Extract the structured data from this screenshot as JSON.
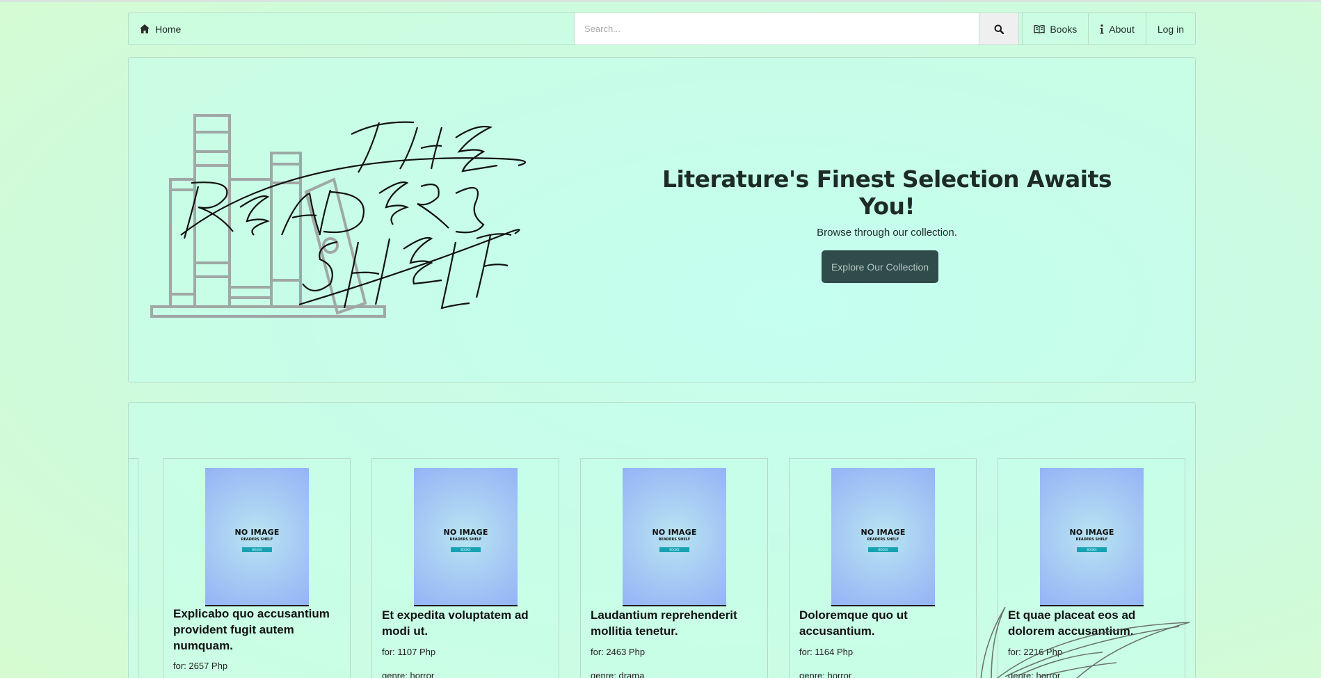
{
  "navbar": {
    "home_label": "Home",
    "search_placeholder": "Search...",
    "items": [
      {
        "label": "Books",
        "icon": "book-icon"
      },
      {
        "label": "About",
        "icon": "info-icon"
      },
      {
        "label": "Log in"
      }
    ]
  },
  "hero": {
    "logo_text": [
      "THE",
      "READERS",
      "SHELF"
    ],
    "title": "Literature's Finest Selection Awaits You!",
    "subtitle": "Browse through our collection.",
    "button_label": "Explore Our Collection"
  },
  "cover_placeholder": {
    "title": "NO IMAGE",
    "subtitle": "READERS SHELF",
    "tag": "BOOKS"
  },
  "books": [
    {
      "title": "Explicabo quo accusantium provident fugit autem numquam.",
      "price": "for: 2657 Php",
      "genre": ""
    },
    {
      "title": "Et expedita voluptatem ad modi ut.",
      "price": "for: 1107 Php",
      "genre": "genre: horror"
    },
    {
      "title": "Laudantium reprehenderit mollitia tenetur.",
      "price": "for: 2463 Php",
      "genre": "genre: drama"
    },
    {
      "title": "Doloremque quo ut accusantium.",
      "price": "for: 1164 Php",
      "genre": "genre: horror"
    },
    {
      "title": "Et quae placeat eos ad dolorem accusantium.",
      "price": "for: 2216 Php",
      "genre": "genre: horror"
    }
  ]
}
